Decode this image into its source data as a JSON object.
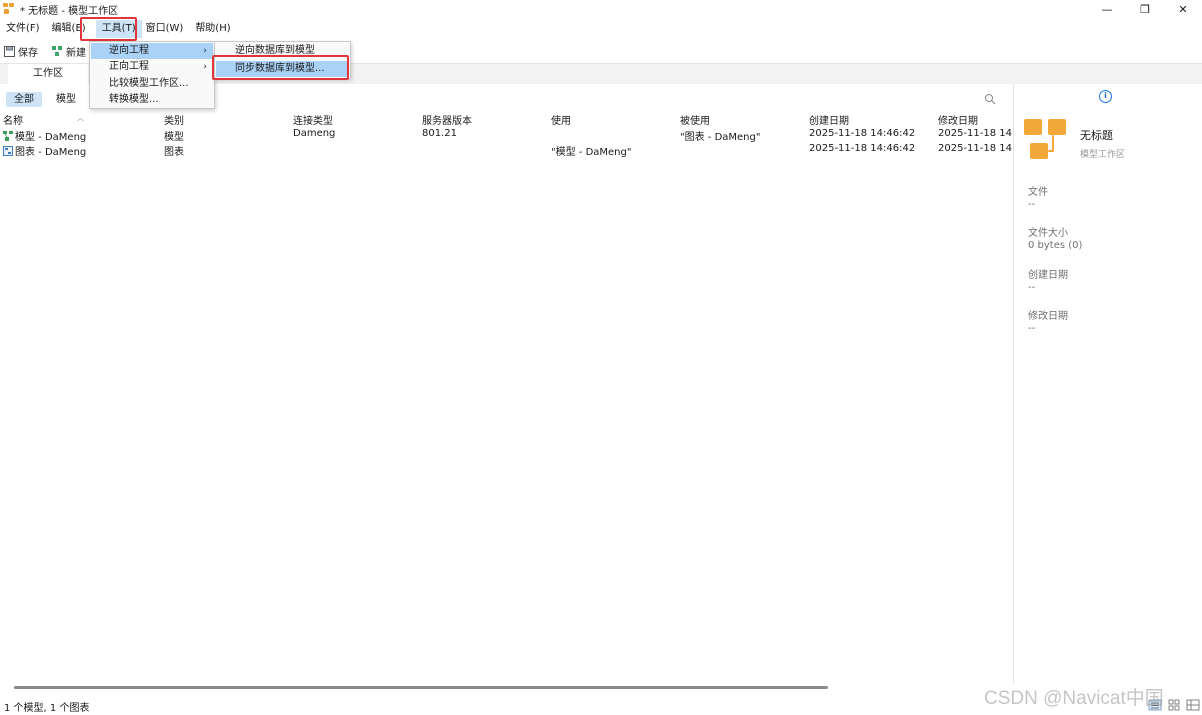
{
  "window": {
    "title": "* 无标题 - 模型工作区",
    "controls": {
      "minimize": "—",
      "maximize": "❐",
      "close": "✕"
    }
  },
  "menubar": {
    "items": [
      "文件(F)",
      "编辑(E)",
      "工具(T)",
      "窗口(W)",
      "帮助(H)"
    ]
  },
  "toolbar": {
    "save_label": "保存",
    "new_label": "新建"
  },
  "tabs": [
    "工作区"
  ],
  "filters": {
    "all": "全部",
    "model": "模型"
  },
  "table": {
    "columns": [
      "名称",
      "类别",
      "连接类型",
      "服务器版本",
      "使用",
      "被使用",
      "创建日期",
      "修改日期"
    ],
    "rows": [
      [
        "模型 - DaMeng",
        "模型",
        "Dameng",
        "801.21",
        "",
        "\"图表 - DaMeng\"",
        "2025-11-18 14:46:42",
        "2025-11-18 14:4"
      ],
      [
        "图表 - DaMeng",
        "图表",
        "",
        "",
        "\"模型 - DaMeng\"",
        "",
        "2025-11-18 14:46:42",
        "2025-11-18 14:4"
      ]
    ]
  },
  "tools_menu": {
    "items": [
      "逆向工程",
      "正向工程",
      "比较模型工作区...",
      "转换模型..."
    ],
    "reverse_submenu": [
      "逆向数据库到模型",
      "同步数据库到模型..."
    ]
  },
  "info_panel": {
    "title": "无标题",
    "subtitle": "模型工作区",
    "file_label": "文件",
    "file_value": "--",
    "size_label": "文件大小",
    "size_value": "0 bytes (0)",
    "created_label": "创建日期",
    "created_value": "--",
    "modified_label": "修改日期",
    "modified_value": "--"
  },
  "status": {
    "text": "1 个模型, 1 个图表"
  },
  "watermark": "CSDN @Navicat中国",
  "colors": {
    "accent": "#f2a838",
    "highlight": "#e0353d",
    "selection": "#a9d2f6"
  }
}
